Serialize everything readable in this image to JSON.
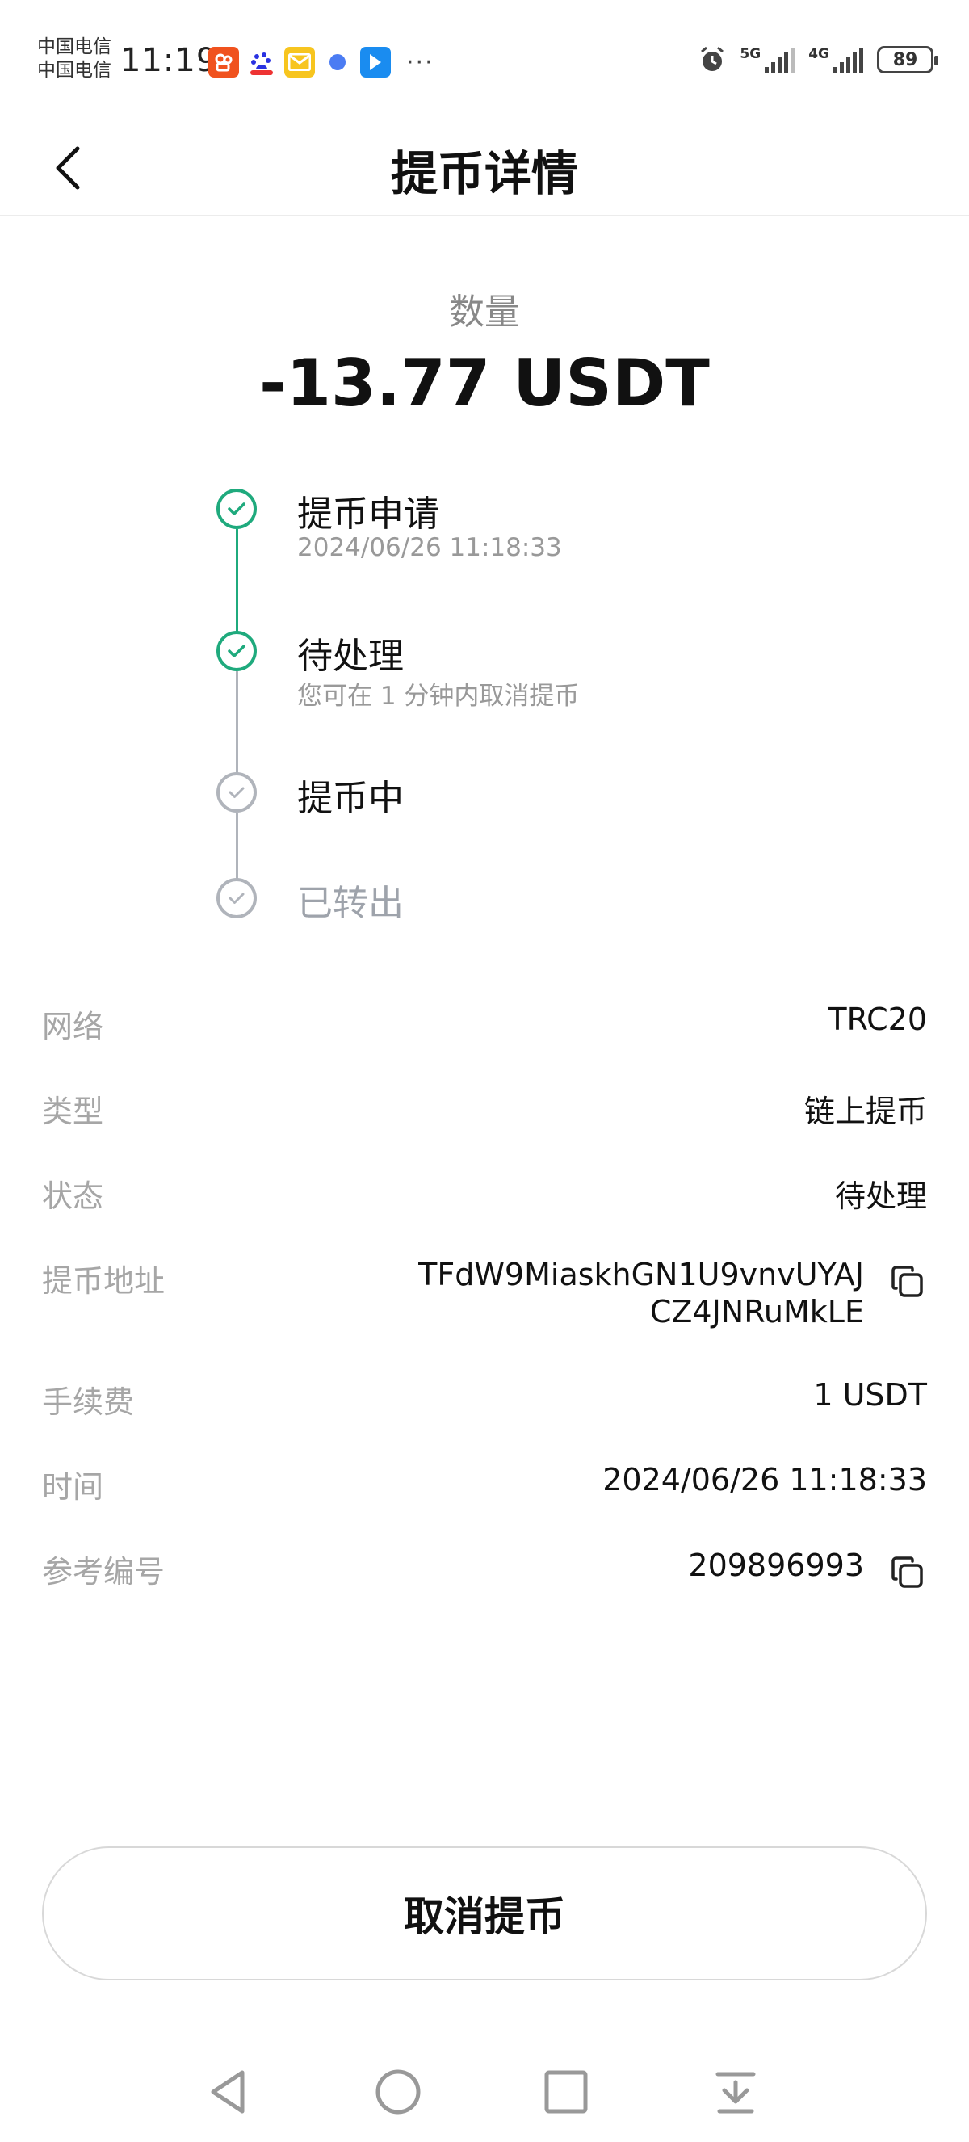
{
  "status_bar": {
    "carrier_1": "中国电信",
    "carrier_2": "中国电信",
    "time": "11:19",
    "battery": "89",
    "net_1": "5G",
    "net_2": "4G",
    "more": "···"
  },
  "header": {
    "title": "提币详情"
  },
  "amount": {
    "label": "数量",
    "value": "-13.77 USDT"
  },
  "timeline": [
    {
      "title": "提币申请",
      "subtitle": "2024/06/26 11:18:33",
      "state": "done"
    },
    {
      "title": "待处理",
      "subtitle": "您可在 1 分钟内取消提币",
      "state": "done"
    },
    {
      "title": "提币中",
      "subtitle": "",
      "state": "pending"
    },
    {
      "title": "已转出",
      "subtitle": "",
      "state": "pending"
    }
  ],
  "details": {
    "network": {
      "label": "网络",
      "value": "TRC20"
    },
    "type": {
      "label": "类型",
      "value": "链上提币"
    },
    "status": {
      "label": "状态",
      "value": "待处理"
    },
    "address": {
      "label": "提币地址",
      "value_line1": "TFdW9MiaskhGN1U9vnvUYAJ",
      "value_line2": "CZ4JNRuMkLE"
    },
    "fee": {
      "label": "手续费",
      "value": "1 USDT"
    },
    "time": {
      "label": "时间",
      "value": "2024/06/26 11:18:33"
    },
    "ref": {
      "label": "参考编号",
      "value": "209896993"
    }
  },
  "cancel_button": "取消提币",
  "colors": {
    "accent_green": "#1faa7d",
    "pending_gray": "#b0b4bb",
    "label_gray": "#a6a6a6"
  }
}
